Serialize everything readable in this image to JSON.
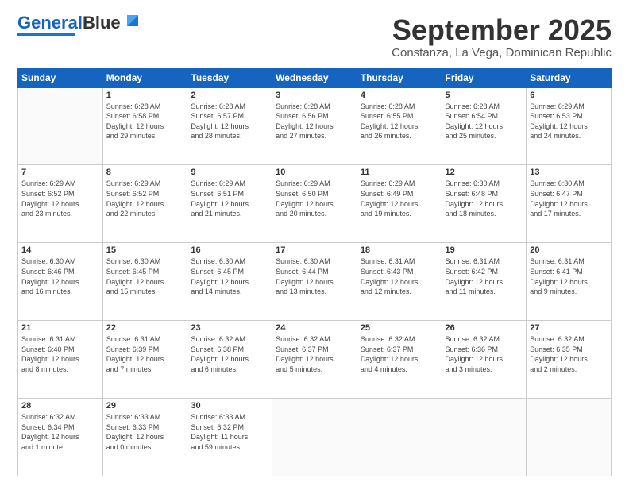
{
  "logo": {
    "part1": "General",
    "part2": "Blue"
  },
  "header": {
    "month": "September 2025",
    "location": "Constanza, La Vega, Dominican Republic"
  },
  "days_of_week": [
    "Sunday",
    "Monday",
    "Tuesday",
    "Wednesday",
    "Thursday",
    "Friday",
    "Saturday"
  ],
  "weeks": [
    [
      {
        "day": "",
        "info": ""
      },
      {
        "day": "1",
        "info": "Sunrise: 6:28 AM\nSunset: 6:58 PM\nDaylight: 12 hours\nand 29 minutes."
      },
      {
        "day": "2",
        "info": "Sunrise: 6:28 AM\nSunset: 6:57 PM\nDaylight: 12 hours\nand 28 minutes."
      },
      {
        "day": "3",
        "info": "Sunrise: 6:28 AM\nSunset: 6:56 PM\nDaylight: 12 hours\nand 27 minutes."
      },
      {
        "day": "4",
        "info": "Sunrise: 6:28 AM\nSunset: 6:55 PM\nDaylight: 12 hours\nand 26 minutes."
      },
      {
        "day": "5",
        "info": "Sunrise: 6:28 AM\nSunset: 6:54 PM\nDaylight: 12 hours\nand 25 minutes."
      },
      {
        "day": "6",
        "info": "Sunrise: 6:29 AM\nSunset: 6:53 PM\nDaylight: 12 hours\nand 24 minutes."
      }
    ],
    [
      {
        "day": "7",
        "info": "Sunrise: 6:29 AM\nSunset: 6:52 PM\nDaylight: 12 hours\nand 23 minutes."
      },
      {
        "day": "8",
        "info": "Sunrise: 6:29 AM\nSunset: 6:52 PM\nDaylight: 12 hours\nand 22 minutes."
      },
      {
        "day": "9",
        "info": "Sunrise: 6:29 AM\nSunset: 6:51 PM\nDaylight: 12 hours\nand 21 minutes."
      },
      {
        "day": "10",
        "info": "Sunrise: 6:29 AM\nSunset: 6:50 PM\nDaylight: 12 hours\nand 20 minutes."
      },
      {
        "day": "11",
        "info": "Sunrise: 6:29 AM\nSunset: 6:49 PM\nDaylight: 12 hours\nand 19 minutes."
      },
      {
        "day": "12",
        "info": "Sunrise: 6:30 AM\nSunset: 6:48 PM\nDaylight: 12 hours\nand 18 minutes."
      },
      {
        "day": "13",
        "info": "Sunrise: 6:30 AM\nSunset: 6:47 PM\nDaylight: 12 hours\nand 17 minutes."
      }
    ],
    [
      {
        "day": "14",
        "info": "Sunrise: 6:30 AM\nSunset: 6:46 PM\nDaylight: 12 hours\nand 16 minutes."
      },
      {
        "day": "15",
        "info": "Sunrise: 6:30 AM\nSunset: 6:45 PM\nDaylight: 12 hours\nand 15 minutes."
      },
      {
        "day": "16",
        "info": "Sunrise: 6:30 AM\nSunset: 6:45 PM\nDaylight: 12 hours\nand 14 minutes."
      },
      {
        "day": "17",
        "info": "Sunrise: 6:30 AM\nSunset: 6:44 PM\nDaylight: 12 hours\nand 13 minutes."
      },
      {
        "day": "18",
        "info": "Sunrise: 6:31 AM\nSunset: 6:43 PM\nDaylight: 12 hours\nand 12 minutes."
      },
      {
        "day": "19",
        "info": "Sunrise: 6:31 AM\nSunset: 6:42 PM\nDaylight: 12 hours\nand 11 minutes."
      },
      {
        "day": "20",
        "info": "Sunrise: 6:31 AM\nSunset: 6:41 PM\nDaylight: 12 hours\nand 9 minutes."
      }
    ],
    [
      {
        "day": "21",
        "info": "Sunrise: 6:31 AM\nSunset: 6:40 PM\nDaylight: 12 hours\nand 8 minutes."
      },
      {
        "day": "22",
        "info": "Sunrise: 6:31 AM\nSunset: 6:39 PM\nDaylight: 12 hours\nand 7 minutes."
      },
      {
        "day": "23",
        "info": "Sunrise: 6:32 AM\nSunset: 6:38 PM\nDaylight: 12 hours\nand 6 minutes."
      },
      {
        "day": "24",
        "info": "Sunrise: 6:32 AM\nSunset: 6:37 PM\nDaylight: 12 hours\nand 5 minutes."
      },
      {
        "day": "25",
        "info": "Sunrise: 6:32 AM\nSunset: 6:37 PM\nDaylight: 12 hours\nand 4 minutes."
      },
      {
        "day": "26",
        "info": "Sunrise: 6:32 AM\nSunset: 6:36 PM\nDaylight: 12 hours\nand 3 minutes."
      },
      {
        "day": "27",
        "info": "Sunrise: 6:32 AM\nSunset: 6:35 PM\nDaylight: 12 hours\nand 2 minutes."
      }
    ],
    [
      {
        "day": "28",
        "info": "Sunrise: 6:32 AM\nSunset: 6:34 PM\nDaylight: 12 hours\nand 1 minute."
      },
      {
        "day": "29",
        "info": "Sunrise: 6:33 AM\nSunset: 6:33 PM\nDaylight: 12 hours\nand 0 minutes."
      },
      {
        "day": "30",
        "info": "Sunrise: 6:33 AM\nSunset: 6:32 PM\nDaylight: 11 hours\nand 59 minutes."
      },
      {
        "day": "",
        "info": ""
      },
      {
        "day": "",
        "info": ""
      },
      {
        "day": "",
        "info": ""
      },
      {
        "day": "",
        "info": ""
      }
    ]
  ]
}
